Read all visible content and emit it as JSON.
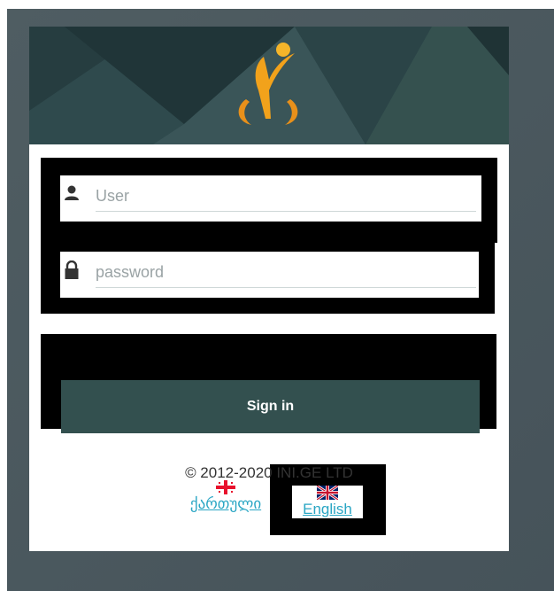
{
  "login": {
    "user_placeholder": "User",
    "password_placeholder": "password",
    "signin_label": "Sign in",
    "copyright": "© 2012-2020 INI.GE LTD"
  },
  "languages": [
    {
      "label": "ქართული",
      "flag": "georgia-flag-icon"
    },
    {
      "label": "English",
      "flag": "uk-flag-icon"
    }
  ],
  "colors": {
    "banner": "#2f4a4d",
    "button": "#33504f",
    "logo_gold": "#f2a21b",
    "link": "#2aa6c4",
    "backdrop": "#4f5d62"
  }
}
